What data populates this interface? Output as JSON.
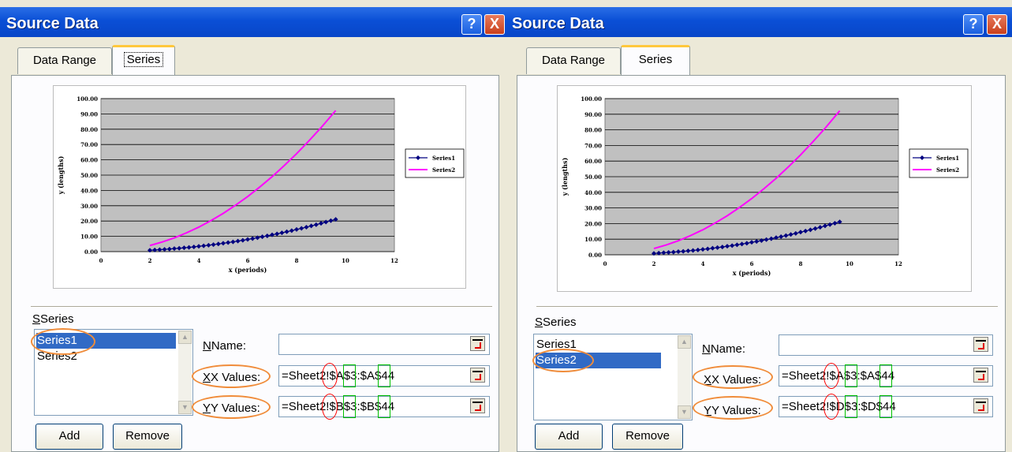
{
  "left": {
    "title": "Source Data",
    "help": "?",
    "close": "X",
    "tabs": [
      "Data Range",
      "Series"
    ],
    "series_group": "Series",
    "series_list": [
      "Series1",
      "Series2"
    ],
    "selected": "Series1",
    "name_label": "Name:",
    "name_value": "",
    "x_label": "X Values:",
    "x_value": "=Sheet2!$A$3:$A$44",
    "y_label": "Y Values:",
    "y_value": "=Sheet2!$B$3:$B$44",
    "add": "Add",
    "remove": "Remove"
  },
  "right": {
    "title": "Source Data",
    "help": "?",
    "close": "X",
    "tabs": [
      "Data Range",
      "Series"
    ],
    "series_group": "Series",
    "series_list": [
      "Series1",
      "Series2"
    ],
    "selected": "Series2",
    "name_label": "Name:",
    "name_value": "",
    "x_label": "X Values:",
    "x_value": "=Sheet2!$A$3:$A$44",
    "y_label": "Y Values:",
    "y_value": "=Sheet2!$D$3:$D$44",
    "add": "Add",
    "remove": "Remove"
  },
  "chart_data": {
    "type": "scatter",
    "xlabel": "x (periods)",
    "ylabel": "y (lengths)",
    "xlim": [
      0,
      12
    ],
    "ylim": [
      0,
      100
    ],
    "xticks": [
      0,
      2,
      4,
      6,
      8,
      10,
      12
    ],
    "yticks": [
      "0.00",
      "10.00",
      "20.00",
      "30.00",
      "40.00",
      "50.00",
      "60.00",
      "70.00",
      "80.00",
      "90.00",
      "100.00"
    ],
    "grid": true,
    "legend": "right",
    "series": [
      {
        "name": "Series1",
        "color": "#000080",
        "marker": "diamond",
        "x": [
          2.0,
          2.2,
          2.4,
          2.6,
          2.8,
          3.0,
          3.2,
          3.4,
          3.6,
          3.8,
          4.0,
          4.2,
          4.4,
          4.6,
          4.8,
          5.0,
          5.2,
          5.4,
          5.6,
          5.8,
          6.0,
          6.2,
          6.4,
          6.6,
          6.8,
          7.0,
          7.2,
          7.4,
          7.6,
          7.8,
          8.0,
          8.2,
          8.4,
          8.6,
          8.8,
          9.0,
          9.2,
          9.4,
          9.6
        ],
        "y": [
          0.9,
          1.1,
          1.3,
          1.5,
          1.7,
          2.0,
          2.2,
          2.5,
          2.8,
          3.1,
          3.5,
          3.8,
          4.2,
          4.6,
          5.0,
          5.5,
          5.9,
          6.4,
          6.9,
          7.4,
          8.0,
          8.5,
          9.1,
          9.7,
          10.3,
          11.0,
          11.6,
          12.3,
          13.0,
          13.7,
          14.5,
          15.2,
          16.0,
          16.8,
          17.6,
          18.5,
          19.3,
          20.2,
          21.1
        ]
      },
      {
        "name": "Series2",
        "color": "#ff00ff",
        "marker": "line",
        "x": [
          2.0,
          2.5,
          3.0,
          3.5,
          4.0,
          4.5,
          5.0,
          5.5,
          6.0,
          6.5,
          7.0,
          7.5,
          8.0,
          8.5,
          9.0,
          9.6
        ],
        "y": [
          4.0,
          6.3,
          9.0,
          12.3,
          16.0,
          20.3,
          25.0,
          30.3,
          36.0,
          42.3,
          49.0,
          56.3,
          64.0,
          72.3,
          81.0,
          92.2
        ]
      }
    ]
  }
}
